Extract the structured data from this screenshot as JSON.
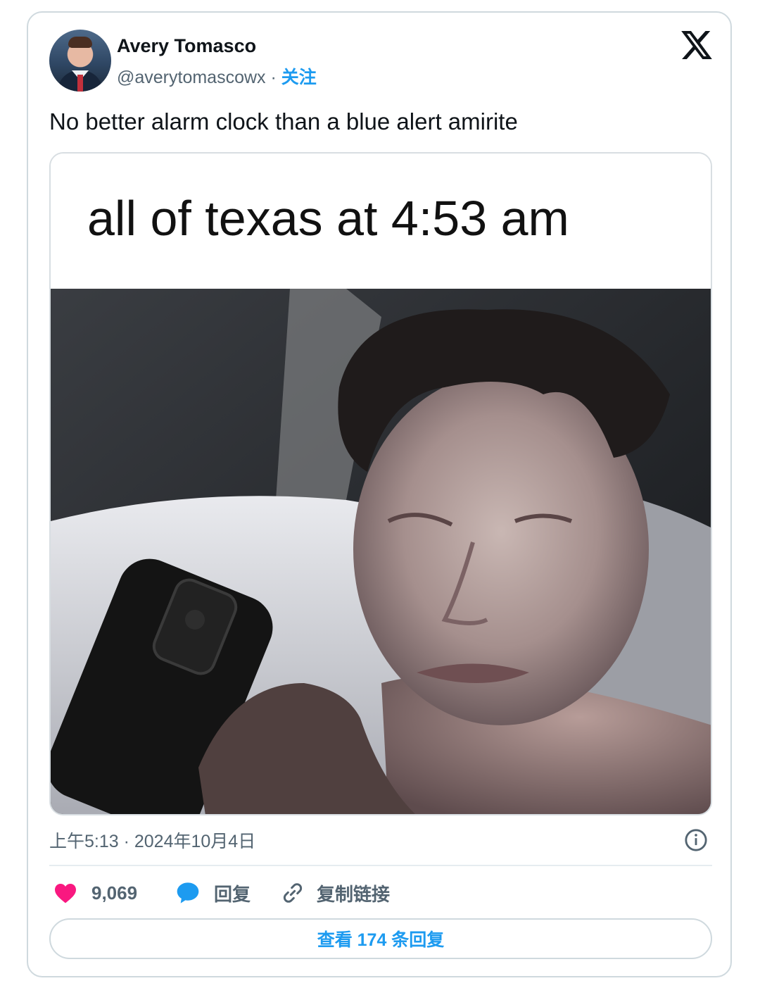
{
  "author": {
    "name": "Avery Tomasco",
    "handle": "@averytomascowx",
    "separator": "·",
    "follow_label": "关注"
  },
  "tweet": {
    "text": "No better alarm clock than a blue alert amirite",
    "media_caption": "all of texas at 4:53 am",
    "timestamp": "上午5:13 · 2024年10月4日"
  },
  "actions": {
    "like_count": "9,069",
    "reply_label": "回复",
    "copy_link_label": "复制链接"
  },
  "view_replies_label": "查看 174 条回复",
  "colors": {
    "accent": "#1d9bf0",
    "like": "#f91880",
    "muted_text": "#536471",
    "primary_text": "#0f1419",
    "border": "#cfd9de"
  },
  "icons": {
    "brand": "x-logo-icon",
    "like": "heart-icon",
    "reply": "speech-bubble-icon",
    "copy": "link-icon",
    "info": "info-icon"
  }
}
